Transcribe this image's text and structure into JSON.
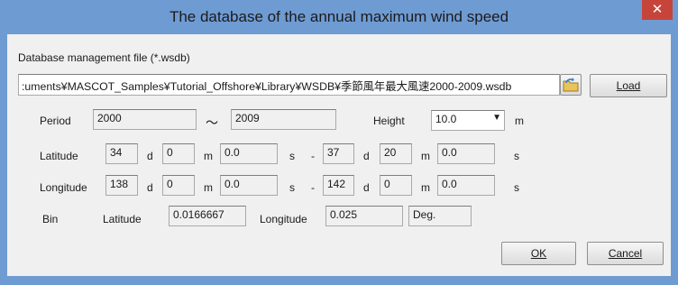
{
  "window": {
    "title": "The database of the annual maximum wind speed",
    "close_glyph": "✕"
  },
  "db": {
    "label": "Database management file (*.wsdb)",
    "path": ":uments¥MASCOT_Samples¥Tutorial_Offshore¥Library¥WSDB¥季節風年最大風速2000-2009.wsdb",
    "browse_icon": "folder-browse-icon",
    "load_label": "Load"
  },
  "period": {
    "label": "Period",
    "start": "2000",
    "tilde": "～",
    "end": "2009"
  },
  "height": {
    "label": "Height",
    "value": "10.0",
    "arrow": "▼",
    "unit": "m"
  },
  "latitude": {
    "label": "Latitude",
    "from_d": "34",
    "from_m": "0",
    "from_s": "0.0",
    "to_d": "37",
    "to_m": "20",
    "to_s": "0.0"
  },
  "longitude": {
    "label": "Longitude",
    "from_d": "138",
    "from_m": "0",
    "from_s": "0.0",
    "to_d": "142",
    "to_m": "0",
    "to_s": "0.0"
  },
  "units": {
    "d": "d",
    "m": "m",
    "s": "s",
    "dash": "-"
  },
  "bin": {
    "label": "Bin",
    "lat_label": "Latitude",
    "lat_value": "0.0166667",
    "lon_label": "Longitude",
    "lon_value": "0.025",
    "deg": "Deg."
  },
  "buttons": {
    "ok": "OK",
    "cancel": "Cancel"
  },
  "colors": {
    "frame": "#6f9bd3",
    "close": "#c7443a",
    "client": "#f0f0f0"
  }
}
